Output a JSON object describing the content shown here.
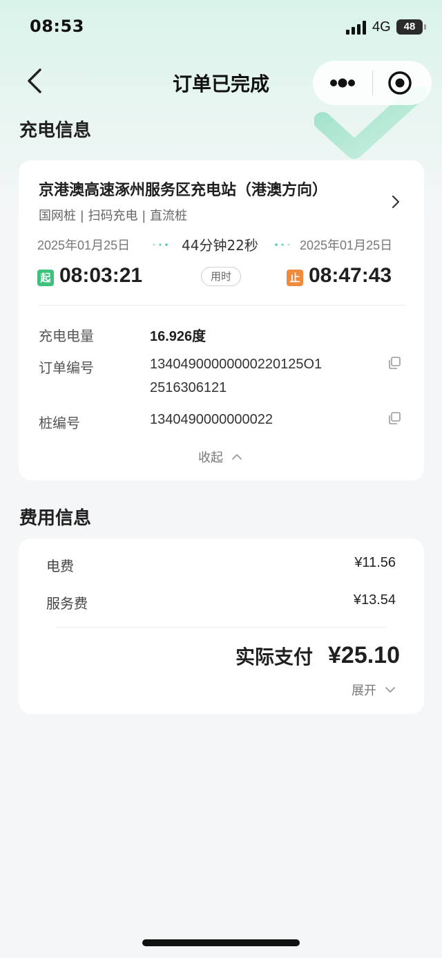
{
  "status_bar": {
    "time": "08:53",
    "network": "4G",
    "battery": "48"
  },
  "nav": {
    "title": "订单已完成"
  },
  "charging_section": {
    "title": "充电信息",
    "station_name": "京港澳高速涿州服务区充电站（港澳方向）",
    "tags": "国网桩 | 扫码充电 | 直流桩",
    "start_date": "2025年01月25日",
    "end_date": "2025年01月25日",
    "duration": "44分钟22秒",
    "start_badge": "起",
    "start_time": "08:03:21",
    "end_badge": "止",
    "end_time": "08:47:43",
    "use_time_label": "用时",
    "details": [
      {
        "label": "充电电量",
        "value": "16.926度"
      },
      {
        "label": "订单编号",
        "value_line1": "13404900000000220125O1",
        "value_line2": "2516306121"
      },
      {
        "label": "桩编号",
        "value": "1340490000000022"
      }
    ],
    "collapse_label": "收起"
  },
  "fee_section": {
    "title": "费用信息",
    "items": [
      {
        "label": "电费",
        "value": "¥11.56"
      },
      {
        "label": "服务费",
        "value": "¥13.54"
      }
    ],
    "total_label": "实际支付",
    "total_value": "¥25.10",
    "expand_label": "展开"
  },
  "colors": {
    "start_badge": "#3ec17c",
    "end_badge": "#f08a3c",
    "accent_green": "#4cc89a"
  }
}
